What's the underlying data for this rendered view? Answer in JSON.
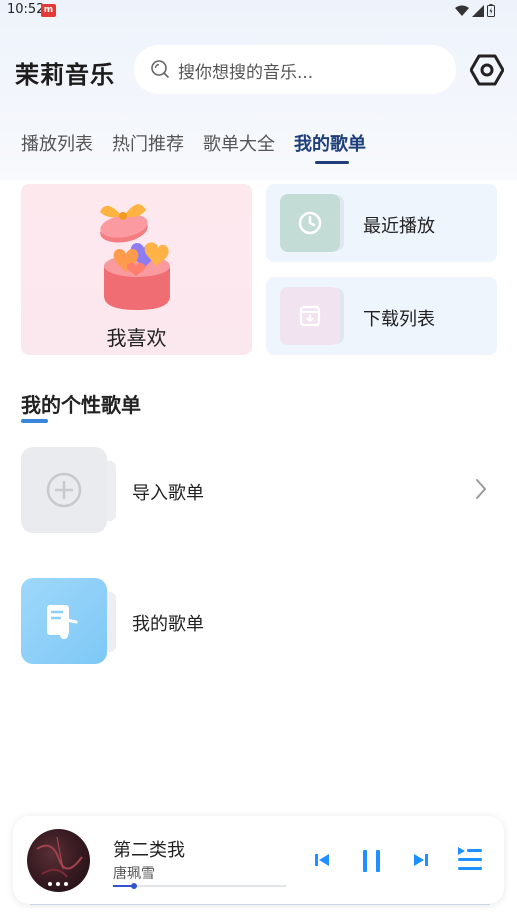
{
  "status_bar": {
    "time": "10:52"
  },
  "header": {
    "app_title": "茉莉音乐",
    "search_placeholder": "搜你想搜的音乐..."
  },
  "tabs": [
    {
      "label": "播放列表",
      "active": false
    },
    {
      "label": "热门推荐",
      "active": false
    },
    {
      "label": "歌单大全",
      "active": false
    },
    {
      "label": "我的歌单",
      "active": true
    }
  ],
  "favorites": {
    "label": "我喜欢"
  },
  "quick_links": [
    {
      "label": "最近播放",
      "icon": "history-icon",
      "color": "#c4dcd6"
    },
    {
      "label": "下载列表",
      "icon": "download-box-icon",
      "color": "#f2e3f0"
    }
  ],
  "section": {
    "title": "我的个性歌单"
  },
  "playlists": [
    {
      "label": "导入歌单",
      "icon": "add-circle-icon"
    },
    {
      "label": "我的歌单",
      "icon": "music-note-document-icon"
    }
  ],
  "player": {
    "title": "第二类我",
    "artist": "唐珮雪",
    "progress": 0.12
  },
  "colors": {
    "accent": "#1f3f7a",
    "player_accent": "#1e90ff",
    "section_underline": "#3a86d8"
  }
}
